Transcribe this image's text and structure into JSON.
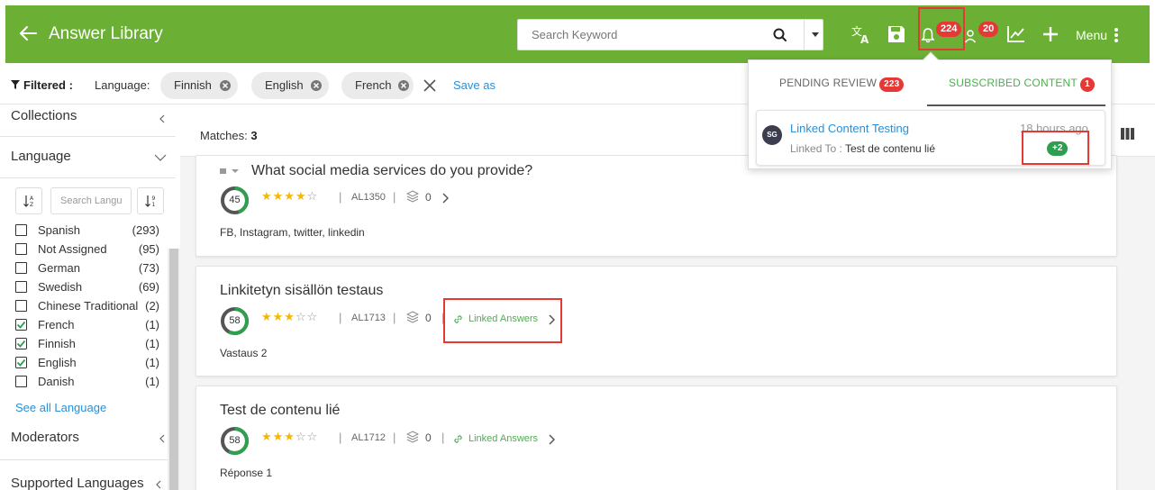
{
  "header": {
    "title": "Answer Library",
    "search_placeholder": "Search Keyword",
    "notifications_count": "224",
    "users_count": "20",
    "menu_label": "Menu"
  },
  "filter": {
    "filtered_label": "Filtered :",
    "language_label": "Language:",
    "chips": [
      "Finnish",
      "English",
      "French"
    ],
    "save_as": "Save as"
  },
  "sidebar": {
    "collections": "Collections",
    "language": "Language",
    "search_placeholder": "Search Langu",
    "languages": [
      {
        "name": "Spanish",
        "count": "(293)",
        "checked": false
      },
      {
        "name": "Not Assigned",
        "count": "(95)",
        "checked": false
      },
      {
        "name": "German",
        "count": "(73)",
        "checked": false
      },
      {
        "name": "Swedish",
        "count": "(69)",
        "checked": false
      },
      {
        "name": "Chinese Traditional",
        "count": "(2)",
        "checked": false
      },
      {
        "name": "French",
        "count": "(1)",
        "checked": true
      },
      {
        "name": "Finnish",
        "count": "(1)",
        "checked": true
      },
      {
        "name": "English",
        "count": "(1)",
        "checked": true
      },
      {
        "name": "Danish",
        "count": "(1)",
        "checked": false
      }
    ],
    "see_all": "See all Language",
    "moderators": "Moderators",
    "supported_languages": "Supported Languages"
  },
  "main": {
    "matches_label": "Matches:",
    "matches_count": "3",
    "cards": [
      {
        "title": "What social media services do you provide?",
        "score": "45",
        "stars": 4,
        "id": "AL1350",
        "layers": "0",
        "linked": "",
        "answer": "FB, Instagram, twitter, linkedin"
      },
      {
        "title": "Linkitetyn sisällön testaus",
        "score": "58",
        "stars": 3,
        "id": "AL1713",
        "layers": "0",
        "linked": "Linked Answers",
        "answer": "Vastaus 2"
      },
      {
        "title": "Test de contenu lié",
        "score": "58",
        "stars": 3,
        "id": "AL1712",
        "layers": "0",
        "linked": "Linked Answers",
        "answer": "Réponse 1"
      }
    ]
  },
  "notifications": {
    "tab_pending": "PENDING REVIEW",
    "tab_pending_count": "223",
    "tab_subscribed": "SUBSCRIBED CONTENT",
    "tab_subscribed_count": "1",
    "item": {
      "avatar": "SG",
      "title": "Linked Content Testing",
      "time": "18 hours ago",
      "linked_to_label": "Linked To :",
      "linked_to_value": "Test de contenu lié",
      "plus": "+2"
    }
  },
  "colors": {
    "header_green": "#6bb034",
    "link_blue": "#2a8fd4",
    "badge_red": "#e53935",
    "score_green": "#2e9e4f"
  }
}
